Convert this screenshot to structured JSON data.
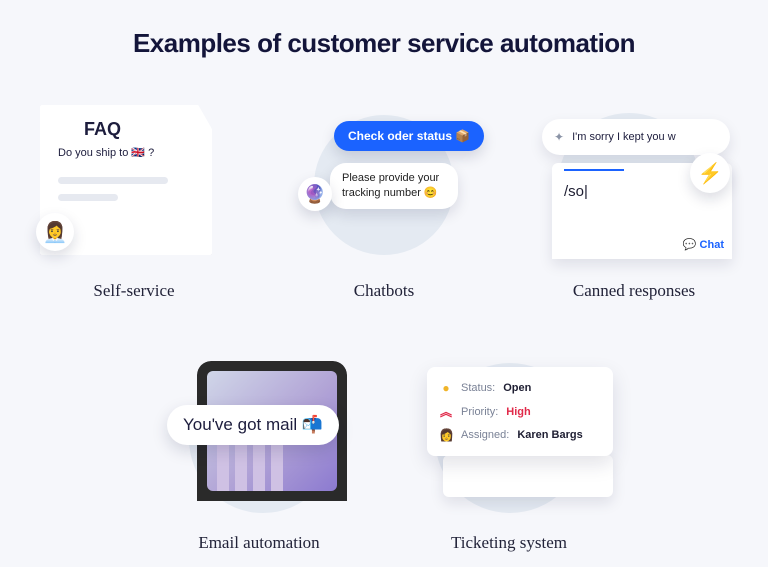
{
  "title": "Examples of customer service automation",
  "tiles": {
    "self_service": {
      "label": "Self-service",
      "faq_heading": "FAQ",
      "question": "Do you ship to 🇬🇧  ?",
      "avatar_emoji": "👩‍💼"
    },
    "chatbots": {
      "label": "Chatbots",
      "user_msg": "Check oder status 📦",
      "bot_msg": "Please provide your tracking number 😊",
      "bot_emoji": "🔮"
    },
    "canned": {
      "label": "Canned responses",
      "tab_text": "I'm sorry I kept you w",
      "slash_text": "/so|",
      "chat_label": "Chat",
      "bolt_emoji": "⚡"
    },
    "email": {
      "label": "Email automation",
      "pill_text": "You've got mail 📬"
    },
    "ticketing": {
      "label": "Ticketing system",
      "status_label": "Status:",
      "status_value": "Open",
      "priority_label": "Priority:",
      "priority_value": "High",
      "assigned_label": "Assigned:",
      "assigned_value": "Karen Bargs"
    }
  }
}
